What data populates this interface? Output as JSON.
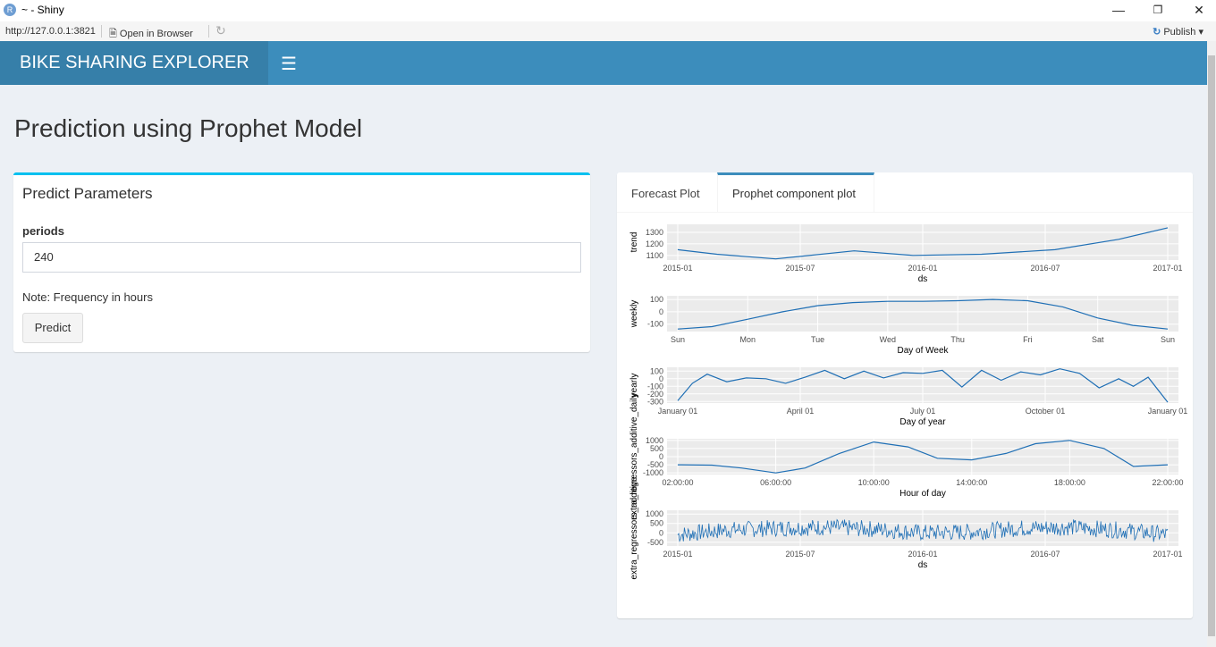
{
  "window": {
    "title": "~ - Shiny",
    "app_icon": "R",
    "url": "http://127.0.0.1:3821",
    "open_in_browser": "Open in Browser",
    "publish": "Publish"
  },
  "header": {
    "brand": "BIKE SHARING EXPLORER",
    "menu_icon": "hamburger-icon"
  },
  "page": {
    "title": "Prediction using Prophet Model"
  },
  "params_box": {
    "title": "Predict Parameters",
    "periods_label": "periods",
    "periods_value": "240",
    "note": "Note: Frequency in hours",
    "predict_button": "Predict"
  },
  "tabs": [
    {
      "label": "Forecast Plot",
      "active": false
    },
    {
      "label": "Prophet component plot",
      "active": true
    }
  ],
  "chart_data": [
    {
      "type": "line",
      "ylabel": "trend",
      "xlabel": "ds",
      "x_ticks": [
        "2015-01",
        "2015-07",
        "2016-01",
        "2016-07",
        "2017-01"
      ],
      "y_ticks": [
        "1100",
        "1200",
        "1300"
      ],
      "ylim": [
        1060,
        1370
      ],
      "x": [
        0,
        0.08,
        0.2,
        0.36,
        0.48,
        0.62,
        0.77,
        0.9,
        1.0
      ],
      "y": [
        1150,
        1110,
        1070,
        1140,
        1100,
        1110,
        1150,
        1240,
        1340
      ],
      "color": "#1f6fb5"
    },
    {
      "type": "line",
      "ylabel": "weekly",
      "xlabel": "Day of Week",
      "x_ticks": [
        "Sun",
        "Mon",
        "Tue",
        "Wed",
        "Thu",
        "Fri",
        "Sat",
        "Sun"
      ],
      "y_ticks": [
        "-100",
        "0",
        "100"
      ],
      "ylim": [
        -160,
        130
      ],
      "x": [
        0,
        0.07,
        0.143,
        0.214,
        0.286,
        0.357,
        0.429,
        0.5,
        0.571,
        0.643,
        0.714,
        0.786,
        0.857,
        0.929,
        1.0
      ],
      "y": [
        -140,
        -120,
        -60,
        0,
        50,
        75,
        85,
        85,
        90,
        100,
        90,
        40,
        -50,
        -110,
        -140
      ],
      "color": "#1f6fb5"
    },
    {
      "type": "line",
      "ylabel": "yearly",
      "xlabel": "Day of year",
      "x_ticks": [
        "January 01",
        "April 01",
        "July 01",
        "October 01",
        "January 01"
      ],
      "y_ticks": [
        "-300",
        "-200",
        "-100",
        "0",
        "100"
      ],
      "ylim": [
        -320,
        150
      ],
      "x": [
        0,
        0.03,
        0.06,
        0.1,
        0.14,
        0.18,
        0.22,
        0.26,
        0.3,
        0.34,
        0.38,
        0.42,
        0.46,
        0.5,
        0.54,
        0.58,
        0.62,
        0.66,
        0.7,
        0.74,
        0.78,
        0.82,
        0.86,
        0.9,
        0.93,
        0.96,
        1.0
      ],
      "y": [
        -290,
        -60,
        60,
        -40,
        10,
        0,
        -60,
        20,
        110,
        0,
        100,
        10,
        80,
        70,
        110,
        -110,
        110,
        -20,
        90,
        50,
        130,
        70,
        -120,
        0,
        -100,
        20,
        -310
      ],
      "color": "#1f6fb5"
    },
    {
      "type": "line",
      "ylabel": "extra_regressors_additive_daily",
      "xlabel": "Hour of day",
      "x_ticks": [
        "02:00:00",
        "06:00:00",
        "10:00:00",
        "14:00:00",
        "18:00:00",
        "22:00:00"
      ],
      "y_ticks": [
        "-1000",
        "-500",
        "0",
        "500",
        "1000"
      ],
      "ylim": [
        -1100,
        1100
      ],
      "x": [
        0,
        0.07,
        0.13,
        0.2,
        0.26,
        0.33,
        0.4,
        0.47,
        0.53,
        0.6,
        0.67,
        0.73,
        0.8,
        0.87,
        0.93,
        1.0
      ],
      "y": [
        -500,
        -520,
        -700,
        -1000,
        -700,
        200,
        900,
        600,
        -100,
        -200,
        200,
        800,
        1000,
        500,
        -600,
        -500
      ],
      "color": "#1f6fb5"
    },
    {
      "type": "line",
      "ylabel": "extra_regressors_additive",
      "xlabel": "ds",
      "x_ticks": [
        "2015-01",
        "2015-07",
        "2016-01",
        "2016-07",
        "2017-01"
      ],
      "y_ticks": [
        "-500",
        "0",
        "500",
        "1000"
      ],
      "ylim": [
        -700,
        1200
      ],
      "noisy": true,
      "x": [
        0,
        0.1,
        0.2,
        0.3,
        0.4,
        0.5,
        0.6,
        0.7,
        0.8,
        0.9,
        1.0
      ],
      "y": [
        -100,
        150,
        250,
        300,
        200,
        0,
        50,
        250,
        300,
        150,
        -100
      ],
      "color": "#1f6fb5"
    }
  ]
}
